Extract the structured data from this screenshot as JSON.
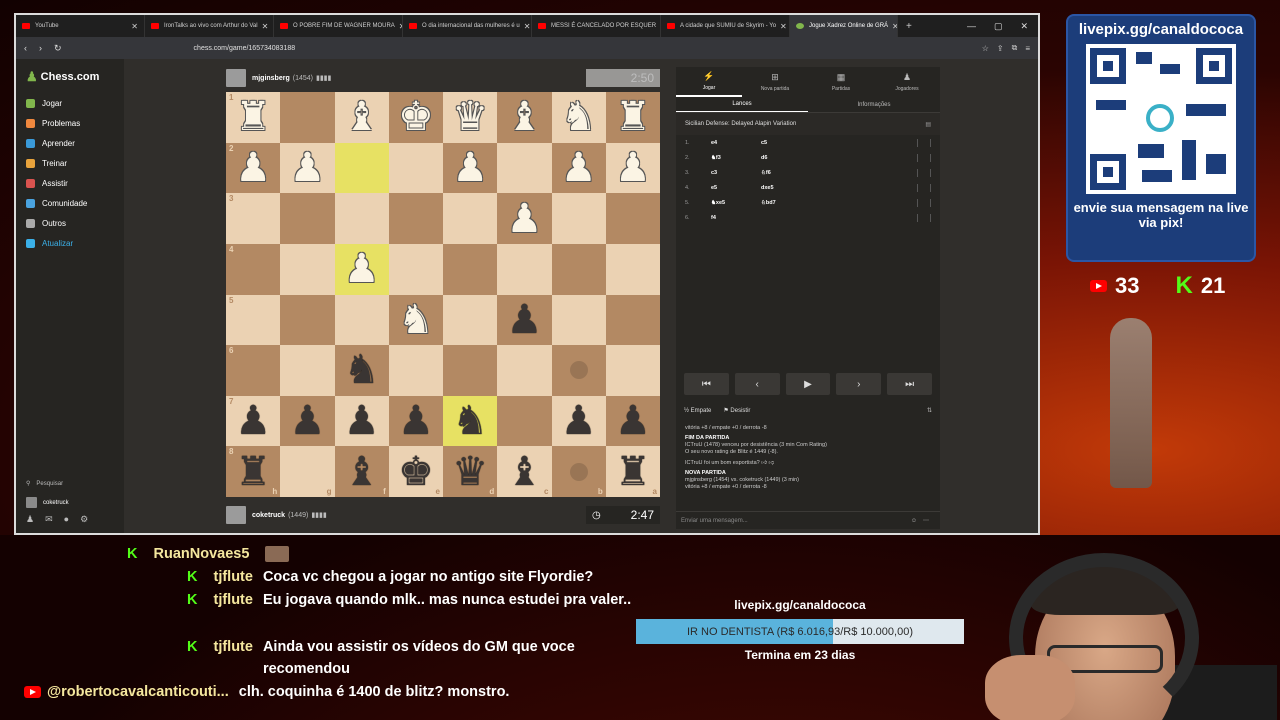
{
  "browser": {
    "tabs": [
      {
        "label": "YouTube",
        "icon": "youtube-icon"
      },
      {
        "label": "IronTalks ao vivo com Arthur do Val",
        "icon": "youtube-icon"
      },
      {
        "label": "O POBRE FIM DE WAGNER MOURA",
        "icon": "youtube-icon"
      },
      {
        "label": "O dia internacional das mulheres é u",
        "icon": "youtube-icon"
      },
      {
        "label": "MESSI É CANCELADO POR ESQUER",
        "icon": "youtube-icon"
      },
      {
        "label": "A cidade que SUMIU de Skyrim - Yo",
        "icon": "youtube-icon"
      },
      {
        "label": "Jogue Xadrez Online de GRÁ",
        "icon": "chess-icon",
        "active": true
      }
    ],
    "url": "chess.com/game/165734083188"
  },
  "sidebar": {
    "logo": "Chess.com",
    "items": [
      {
        "label": "Jogar",
        "color": "#81b64c"
      },
      {
        "label": "Problemas",
        "color": "#f0883e"
      },
      {
        "label": "Aprender",
        "color": "#3a9ad9"
      },
      {
        "label": "Treinar",
        "color": "#e8a33c"
      },
      {
        "label": "Assistir",
        "color": "#d9534f"
      },
      {
        "label": "Comunidade",
        "color": "#4aa3df"
      },
      {
        "label": "Outros",
        "color": "#aaaaaa"
      },
      {
        "label": "Atualizar",
        "color": "#3bb0e8",
        "highlight": true
      }
    ],
    "search": "Pesquisar",
    "user": "coketruck"
  },
  "game": {
    "top_player": {
      "name": "mjginsberg",
      "rating": "(1454)",
      "flags": "▮▮▮▮",
      "clock": "2:50"
    },
    "bottom_player": {
      "name": "coketruck",
      "rating": "(1449)",
      "flags": "▮▮▮▮",
      "clock": "2:47"
    },
    "board": [
      [
        "wR",
        "",
        "wB",
        "wK",
        "wQ",
        "wB",
        "wN",
        "wR"
      ],
      [
        "wP",
        "wP",
        "",
        "",
        "wP",
        "",
        "wP",
        "wP"
      ],
      [
        "",
        "",
        "",
        "",
        "",
        "wP",
        "",
        ""
      ],
      [
        "",
        "",
        "wP",
        "",
        "",
        "",
        "",
        ""
      ],
      [
        "",
        "",
        "",
        "wN",
        "",
        "bP",
        "",
        ""
      ],
      [
        "",
        "",
        "bN",
        "",
        "",
        "",
        "",
        ""
      ],
      [
        "bP",
        "bP",
        "bP",
        "bP",
        "bN",
        "",
        "bP",
        "bP"
      ],
      [
        "bR",
        "",
        "bB",
        "bK",
        "bQ",
        "bB",
        "",
        "bR"
      ]
    ],
    "highlights": [
      "2-3",
      "4-3",
      "7-5"
    ],
    "hints": [
      "6-7",
      "8-7"
    ],
    "rank_labels": [
      "1",
      "2",
      "3",
      "4",
      "5",
      "6",
      "7",
      "8"
    ],
    "file_labels": [
      "h",
      "g",
      "f",
      "e",
      "d",
      "c",
      "b",
      "a"
    ]
  },
  "panel": {
    "tabs": [
      "Jogar",
      "Nova partida",
      "Partidas",
      "Jogadores"
    ],
    "subtabs": [
      "Lances",
      "Informações"
    ],
    "opening": "Sicilian Defense: Delayed Alapin Variation",
    "moves": [
      {
        "n": "1.",
        "w": "e4",
        "b": "c5"
      },
      {
        "n": "2.",
        "w": "♞f3",
        "b": "d6"
      },
      {
        "n": "3.",
        "w": "c3",
        "b": "♘f6"
      },
      {
        "n": "4.",
        "w": "e5",
        "b": "dxe5"
      },
      {
        "n": "5.",
        "w": "♞xe5",
        "b": "♘bd7"
      },
      {
        "n": "6.",
        "w": "f4",
        "b": ""
      }
    ],
    "draw": "Empate",
    "resign": "Desistir",
    "log": [
      "vitória +8 / empate +0 / derrota -8",
      "FIM DA PARTIDA",
      "ICTruU (1478) venceu por desistência (3 min Com Rating)",
      "O seu novo rating de Blitz é 1449 (-8).",
      "ICTruU foi um bom esportista?",
      "NOVA PARTIDA",
      "mjginsberg (1454) vs. coketruck (1449) (3 min)",
      "vitória +8 / empate +0 / derrota -8"
    ],
    "chat_placeholder": "Enviar uma mensagem..."
  },
  "livepix": {
    "title": "livepix.gg/canaldococa",
    "message": "envie sua mensagem na live via pix!"
  },
  "counts": {
    "youtube": "33",
    "kick": "21"
  },
  "chat": [
    {
      "platform": "kick",
      "user": "RuanNovaes5",
      "msg": ""
    },
    {
      "platform": "kick",
      "user": "tjflute",
      "msg": "Coca vc chegou a jogar no antigo site Flyordie?"
    },
    {
      "platform": "kick",
      "user": "tjflute",
      "msg": "Eu jogava quando mlk.. mas nunca estudei pra valer.."
    },
    {
      "platform": "kick",
      "user": "tjflute",
      "msg": "Ainda vou assistir os vídeos do GM que voce recomendou"
    },
    {
      "platform": "youtube",
      "user": "@robertocavalcanticouti...",
      "msg": "clh. coquinha é 1400 de blitz? monstro."
    }
  ],
  "goal": {
    "title": "livepix.gg/canaldococa",
    "bar_text": "IR NO DENTISTA (R$ 6.016,93/R$ 10.000,00)",
    "progress": 0.6017,
    "sub": "Termina em 23 dias"
  }
}
